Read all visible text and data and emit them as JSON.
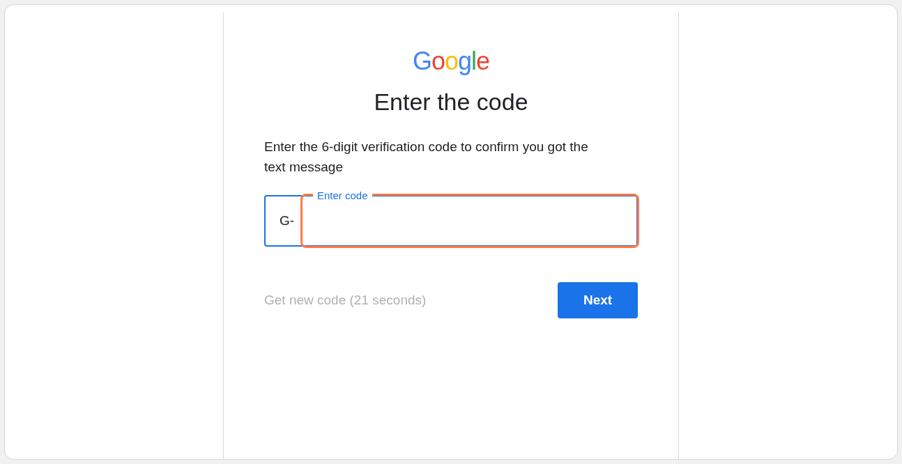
{
  "logo": "Google",
  "title": "Enter the code",
  "description": "Enter the 6-digit verification code to confirm you got the text message",
  "code_field": {
    "prefix": "G-",
    "label": "Enter code",
    "focused": true,
    "highlighted": true
  },
  "resend_link": {
    "label": "Get new code (21 seconds)",
    "disabled": true
  },
  "next_button": {
    "label": "Next"
  }
}
